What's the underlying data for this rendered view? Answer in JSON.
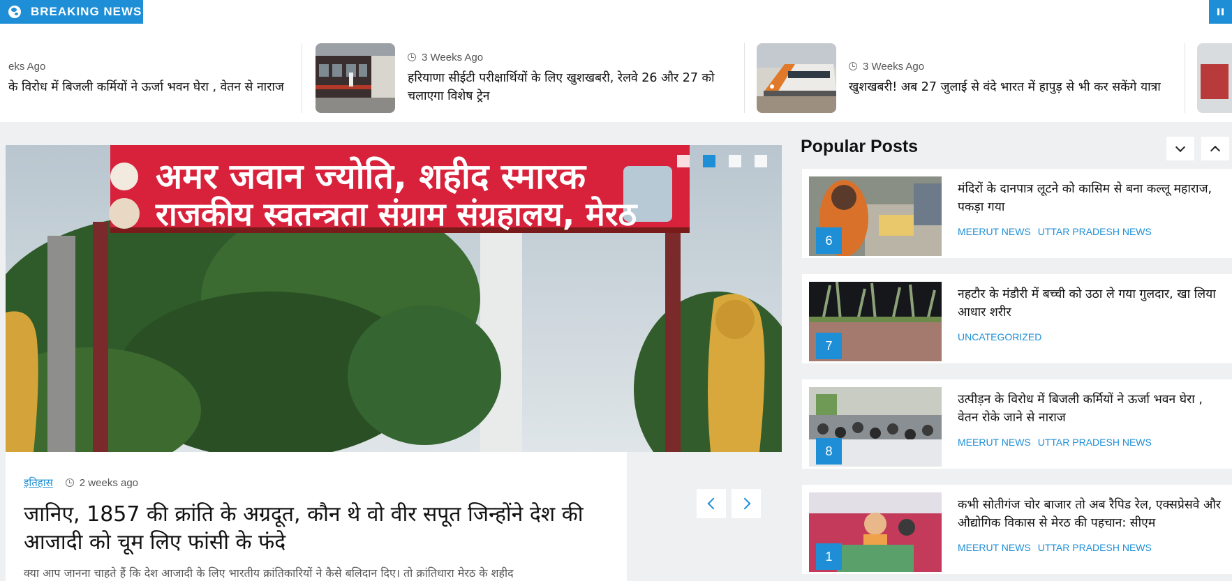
{
  "breaking": {
    "label": "BREAKING NEWS"
  },
  "ticker": [
    {
      "time": "eks Ago",
      "title": "के विरोध में बिजली कर्मियों ने ऊर्जा भवन घेरा , वेतन से नाराज"
    },
    {
      "time": "3 Weeks Ago",
      "title": "हरियाणा सीईटी परीक्षार्थियों के लिए खुशखबरी, रेलवे 26 और 27 को चलाएगा विशेष ट्रेन"
    },
    {
      "time": "3 Weeks Ago",
      "title": "खुशखबरी! अब 27 जुलाई से वंदे भारत में हापुड़ से भी कर सकेंगे यात्रा"
    }
  ],
  "slider": {
    "sign_line1": "अमर जवान ज्योति, शहीद स्मारक",
    "sign_line2": "राजकीय स्वतन्त्रता संग्राम संग्रहालय, मेरठ",
    "dots_count": 4,
    "active_dot": 1,
    "category": "इतिहास",
    "time": "2 weeks ago",
    "title": "जानिए, 1857 की क्रांति के अग्रदूत, कौन थे वो वीर सपूत जिन्होंने देश की आजादी को चूम लिए फांसी के फंदे",
    "excerpt": "क्या आप जानना चाहते हैं कि देश आजादी के लिए भारतीय क्रांतिकारियों ने कैसे बलिदान दिए। तो क्रांतिधारा मेरठ के शहीद"
  },
  "popular": {
    "heading": "Popular Posts",
    "posts": [
      {
        "num": "6",
        "title": "मंदिरों के दानपात्र लूटने को कासिम से बना कल्लू महाराज, पकड़ा गया",
        "cats": [
          "MEERUT NEWS",
          "UTTAR PRADESH NEWS"
        ]
      },
      {
        "num": "7",
        "title": "नहटौर के मंडौरी में बच्ची को उठा ले गया गुलदार, खा लिया आधार शरीर",
        "cats": [
          "UNCATEGORIZED"
        ]
      },
      {
        "num": "8",
        "title": "उत्पीड़न के विरोध में बिजली कर्मियों ने ऊर्जा भवन घेरा , वेतन रोके जाने से नाराज",
        "cats": [
          "MEERUT NEWS",
          "UTTAR PRADESH NEWS"
        ]
      },
      {
        "num": "1",
        "title": "कभी सोतीगंज चोर बाजार तो अब रैपिड रेल, एक्सप्रेसवे और औद्योगिक विकास से मेरठ की पहचान: सीएम",
        "cats": [
          "MEERUT NEWS",
          "UTTAR PRADESH NEWS"
        ]
      }
    ]
  },
  "colors": {
    "accent": "#1e8fd6",
    "sign_red": "#d8213a",
    "background": "#eef0f2"
  },
  "icons": {
    "breaking": "globe-icon",
    "pause": "pause-icon",
    "time": "clock-icon",
    "prev": "chevron-left-icon",
    "next": "chevron-right-icon",
    "pp_down": "chevron-down-icon",
    "pp_up": "chevron-up-icon"
  }
}
